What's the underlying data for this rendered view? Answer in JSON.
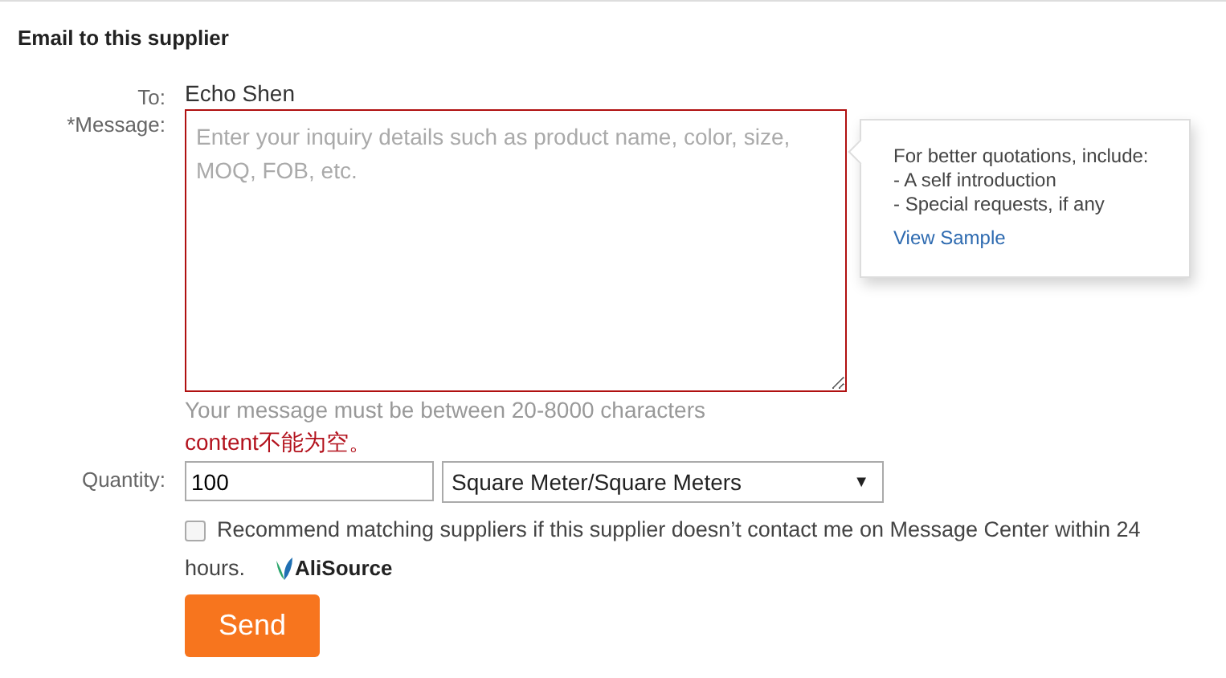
{
  "title": "Email to this supplier",
  "to": {
    "label": "To:",
    "value": "Echo Shen"
  },
  "message": {
    "label": "*Message:",
    "placeholder": "Enter your inquiry details such as product name, color, size, MOQ, FOB, etc.",
    "invalid": true,
    "hint": "Your message must be between 20-8000 characters",
    "error": "content不能为空。"
  },
  "tooltip": {
    "lines": [
      "For better quotations, include:",
      "- A self introduction",
      "- Special requests, if any"
    ],
    "link": "View Sample"
  },
  "quantity": {
    "label": "Quantity:",
    "value": "100",
    "unit": "Square Meter/Square Meters",
    "caret": "▼"
  },
  "recommend": {
    "checked": false,
    "text_lines": [
      "Recommend matching suppliers if this supplier doesn’t contact me on Message Center within 24",
      "hours."
    ],
    "logo": "AliSource"
  },
  "send_button": "Send"
}
